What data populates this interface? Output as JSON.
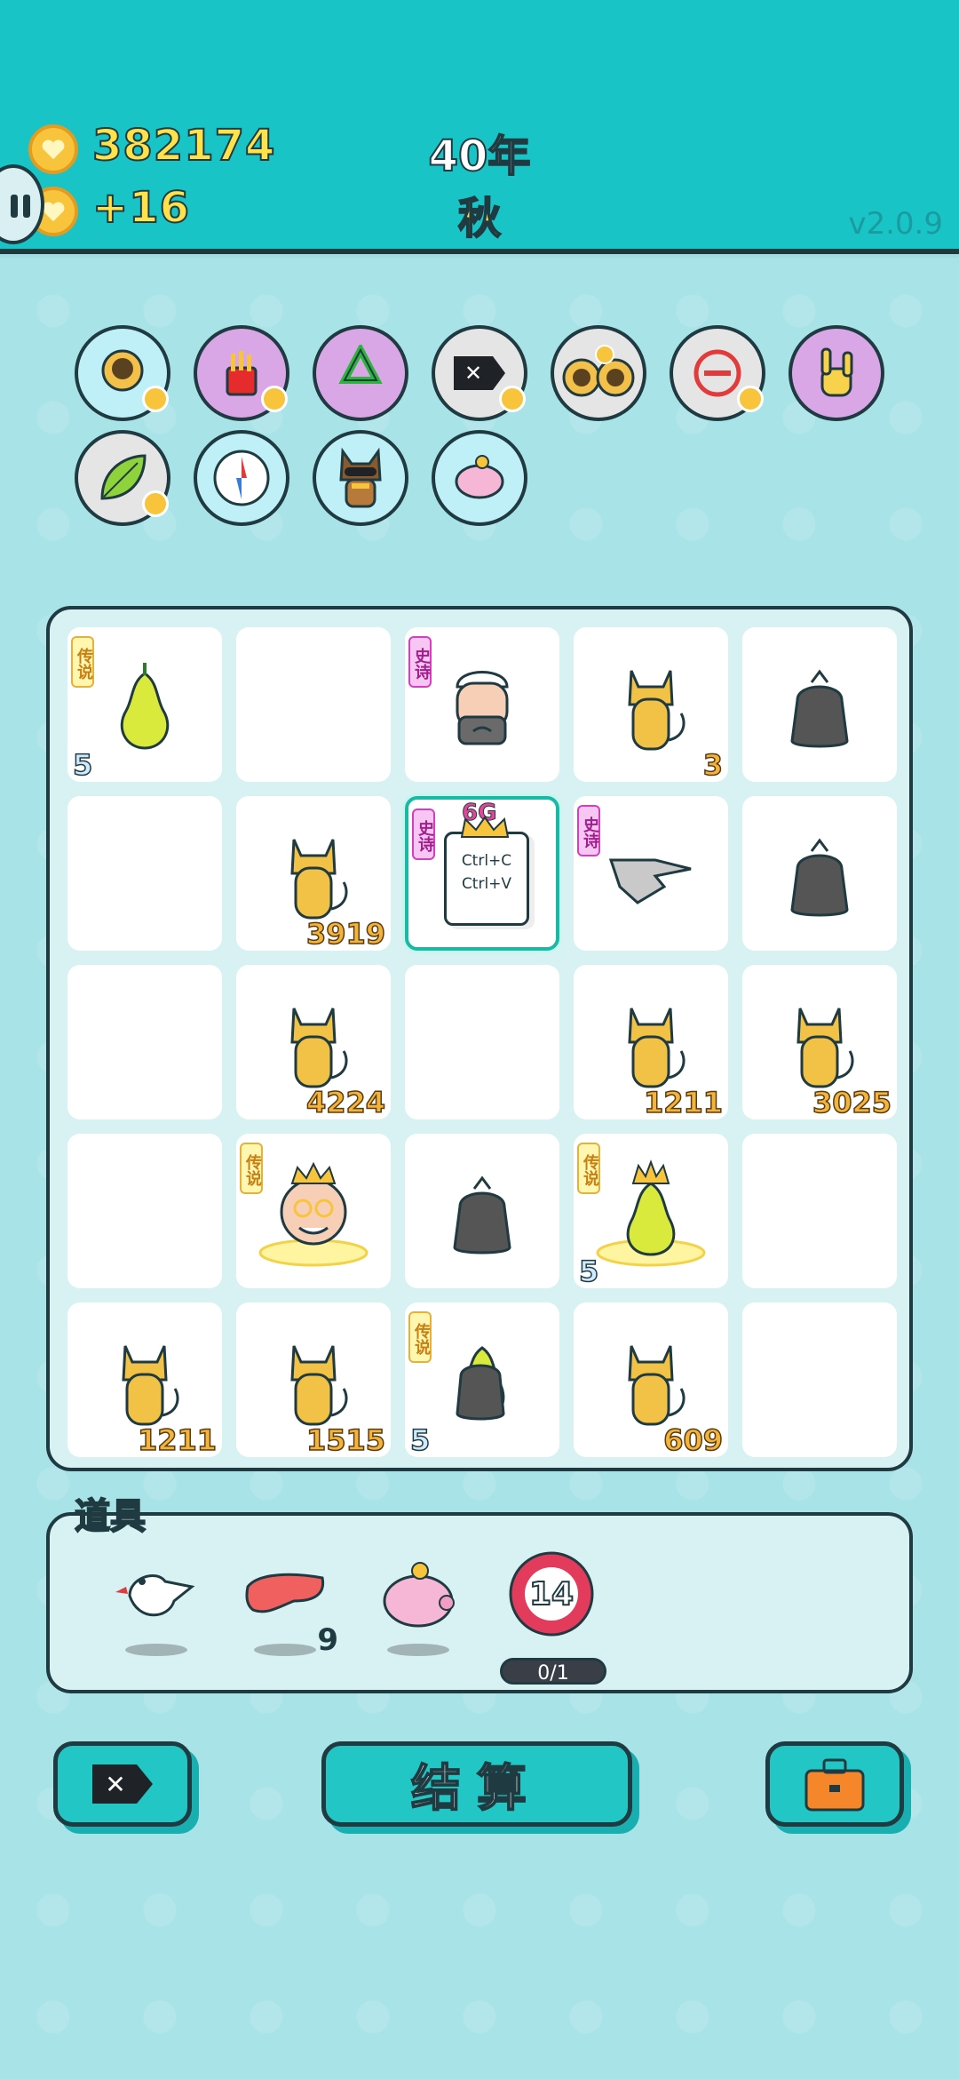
{
  "header": {
    "coins": "382174",
    "income": "+16",
    "year": "40年",
    "season": "秋",
    "version": "v2.0.9"
  },
  "skills": [
    {
      "name": "cat-skill",
      "bg": "#bfeff7"
    },
    {
      "name": "fries-skill",
      "bg": "#d9a6e6"
    },
    {
      "name": "recycle-skill",
      "bg": "#d9a6e6"
    },
    {
      "name": "delete-tag-skill",
      "bg": "#e5e5e5"
    },
    {
      "name": "twin-cats-skill",
      "bg": "#e5e5e5"
    },
    {
      "name": "minus-skill",
      "bg": "#e5e5e5"
    },
    {
      "name": "rock-hand-skill",
      "bg": "#d9a6e6"
    },
    {
      "name": "leaf-skill",
      "bg": "#e5e5e5"
    },
    {
      "name": "compass-skill",
      "bg": "#bfeff7"
    },
    {
      "name": "dog-skill",
      "bg": "#bfeff7"
    },
    {
      "name": "piggy-skill",
      "bg": "#bfeff7"
    }
  ],
  "board": {
    "rarity_legend": "传说",
    "rarity_epic": "史诗",
    "ctrl_c": "Ctrl+C",
    "ctrl_v": "Ctrl+V",
    "g6": "6G",
    "counts": {
      "r1c1": "5",
      "r1c4": "3",
      "r2c2": "3919",
      "r3c2": "4224",
      "r3c4": "1211",
      "r3c5": "3025",
      "r4c4": "5",
      "r5c1": "1211",
      "r5c2": "1515",
      "r5c3": "5",
      "r5c4": "609"
    }
  },
  "items": {
    "title": "道具",
    "liver_count": "9",
    "target_number": "14",
    "target_progress": "0/1"
  },
  "buttons": {
    "settle": "结算"
  }
}
